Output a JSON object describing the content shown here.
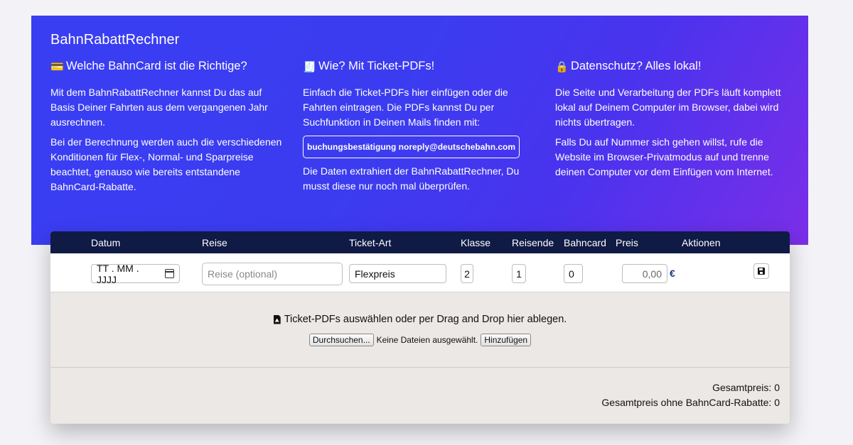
{
  "hero": {
    "title": "BahnRabattRechner",
    "col1": {
      "icon": "credit-card",
      "heading": "Welche BahnCard ist die Richtige?",
      "p1": "Mit dem BahnRabattRechner kannst Du das auf Basis Deiner Fahrten aus dem vergangenen Jahr ausrechnen.",
      "p2": "Bei der Berechnung werden auch die verschiedenen Konditionen für Flex-, Normal- und Sparpreise beachtet, genauso wie bereits entstandene BahnCard-Rabatte."
    },
    "col2": {
      "icon": "receipt",
      "heading": "Wie? Mit Ticket-PDFs!",
      "p1": "Einfach die Ticket-PDFs hier einfügen oder die Fahrten eintragen. Die PDFs kannst Du per Suchfunktion in Deinen Mails finden mit:",
      "search_term": "buchungsbestätigung noreply@deutschebahn.com",
      "p2": "Die Daten extrahiert der BahnRabattRechner, Du musst diese nur noch mal überprüfen."
    },
    "col3": {
      "icon": "lock",
      "heading": "Datenschutz? Alles lokal!",
      "p1": "Die Seite und Verarbeitung der PDFs läuft komplett lokal auf Deinem Computer im Browser, dabei wird nichts übertragen.",
      "p2": "Falls Du auf Nummer sich gehen willst, rufe die Website im Browser-Privatmodus auf und trenne deinen Computer vor dem Einfügen vom Internet."
    },
    "gradient_colors": [
      "#3a3ef2",
      "#7b2ee8"
    ]
  },
  "table": {
    "headers": {
      "datum": "Datum",
      "reise": "Reise",
      "ticket_art": "Ticket-Art",
      "klasse": "Klasse",
      "reisende": "Reisende",
      "bahncard": "Bahncard",
      "preis": "Preis",
      "aktionen": "Aktionen"
    },
    "row": {
      "date_placeholder": "TT . MM . JJJJ",
      "reise_placeholder": "Reise (optional)",
      "ticket_art": "Flexpreis",
      "klasse": "2",
      "reisende": "1",
      "bahncard": "0",
      "preis": "0,00",
      "currency": "€"
    },
    "header_bg": "#0f1a45"
  },
  "drop": {
    "text": "Ticket-PDFs auswählen oder per Drag and Drop hier ablegen.",
    "browse_label": "Durchsuchen...",
    "no_file_text": "Keine Dateien ausgewählt.",
    "add_label": "Hinzufügen"
  },
  "totals": {
    "gesamtpreis": "Gesamtpreis: 0",
    "ohne_rabatte": "Gesamtpreis ohne BahnCard-Rabatte: 0"
  }
}
